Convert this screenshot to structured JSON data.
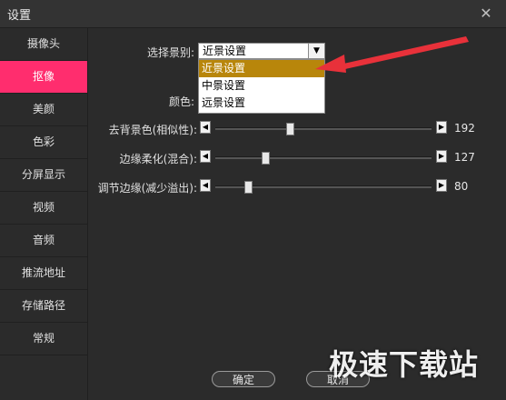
{
  "window": {
    "title": "设置"
  },
  "sidebar": {
    "items": [
      {
        "label": "摄像头"
      },
      {
        "label": "抠像"
      },
      {
        "label": "美颜"
      },
      {
        "label": "色彩"
      },
      {
        "label": "分屏显示"
      },
      {
        "label": "视频"
      },
      {
        "label": "音频"
      },
      {
        "label": "推流地址"
      },
      {
        "label": "存储路径"
      },
      {
        "label": "常规"
      }
    ],
    "active_index": 1
  },
  "scene": {
    "label": "选择景别:",
    "selected_value": "近景设置",
    "options": [
      "近景设置",
      "中景设置",
      "远景设置"
    ],
    "highlighted_index": 0
  },
  "color": {
    "label": "颜色:"
  },
  "sliders": [
    {
      "label": "去背景色(相似性):",
      "value": 192,
      "max": 255
    },
    {
      "label": "边缘柔化(混合):",
      "value": 127,
      "max": 255
    },
    {
      "label": "调节边缘(减少溢出):",
      "value": 80,
      "max": 255
    }
  ],
  "buttons": {
    "ok": "确定",
    "cancel": "取消"
  },
  "watermark": "极速下载站",
  "colors": {
    "accent": "#ff2d6e",
    "highlight": "#b8860b",
    "arrow": "#e8313a"
  },
  "icons": {
    "close": "close-icon",
    "dropdown": "triangle-down-icon"
  }
}
